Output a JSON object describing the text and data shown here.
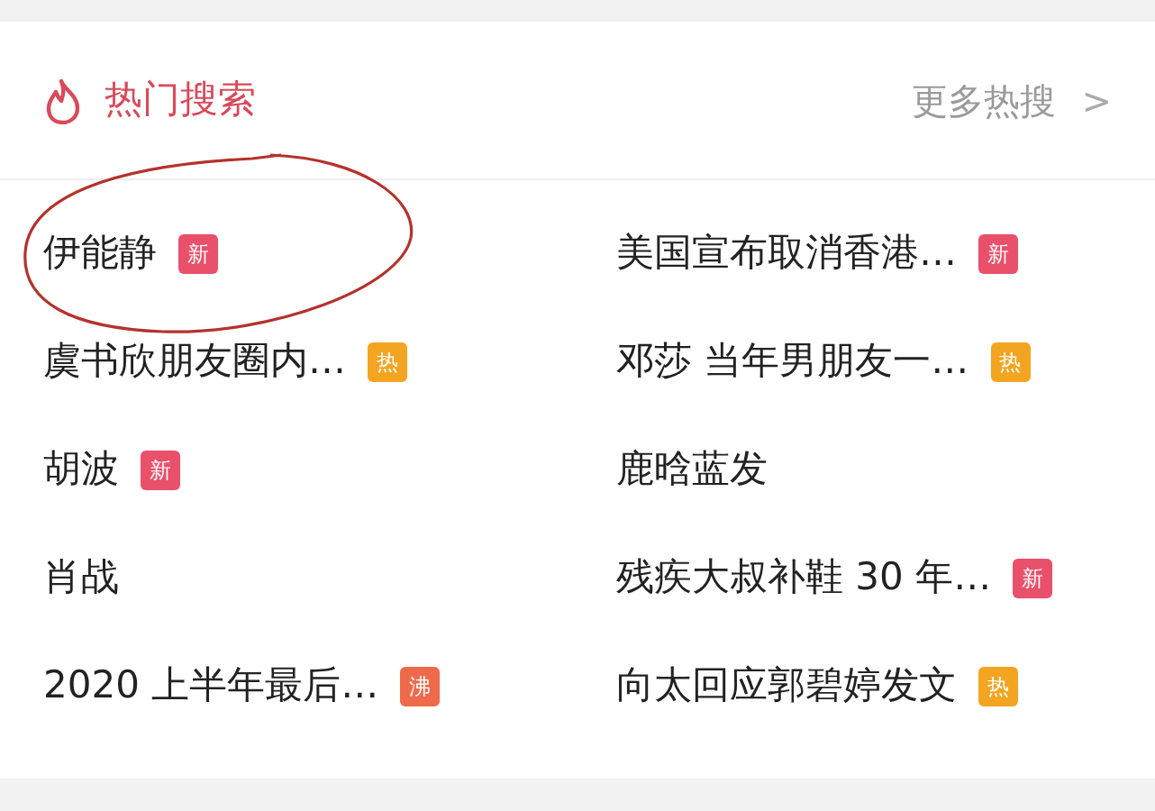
{
  "header": {
    "title": "热门搜索",
    "more": "更多热搜",
    "chevron": ">"
  },
  "items": [
    {
      "text": "伊能静",
      "badge": {
        "label": "新",
        "color": "#e9506a"
      }
    },
    {
      "text": "美国宣布取消香港…",
      "badge": {
        "label": "新",
        "color": "#e9506a"
      }
    },
    {
      "text": "虞书欣朋友圈内…",
      "badge": {
        "label": "热",
        "color": "#f3a521"
      }
    },
    {
      "text": "邓莎 当年男朋友一…",
      "badge": {
        "label": "热",
        "color": "#f3a521"
      }
    },
    {
      "text": "胡波",
      "badge": {
        "label": "新",
        "color": "#e9506a"
      }
    },
    {
      "text": "鹿晗蓝发"
    },
    {
      "text": "肖战"
    },
    {
      "text": "残疾大叔补鞋 30 年…",
      "badge": {
        "label": "新",
        "color": "#e9506a"
      }
    },
    {
      "text": "2020 上半年最后…",
      "badge": {
        "label": "沸",
        "color": "#ee6a4a"
      }
    },
    {
      "text": "向太回应郭碧婷发文",
      "badge": {
        "label": "热",
        "color": "#f3a521"
      }
    }
  ],
  "annotation": {
    "kind": "hand-drawn-circle"
  }
}
